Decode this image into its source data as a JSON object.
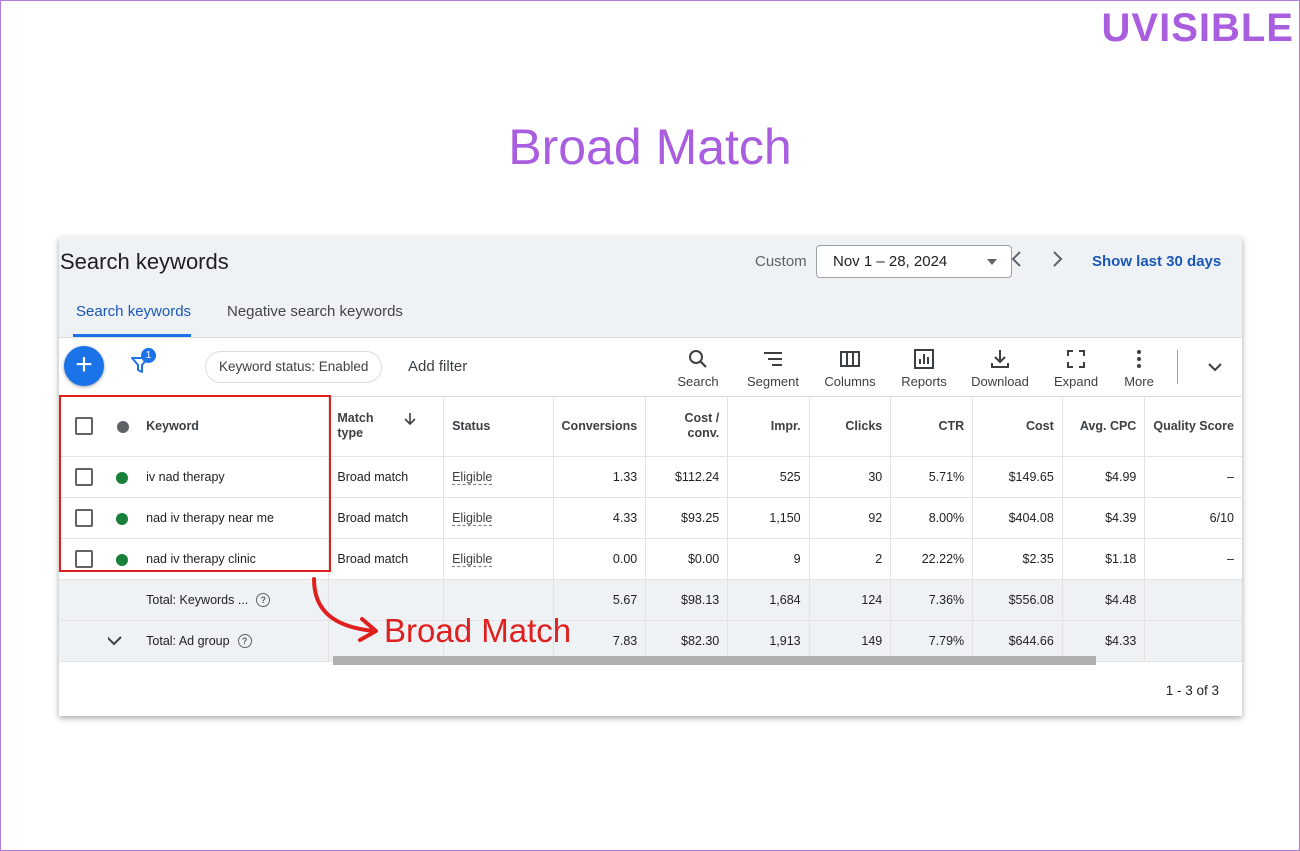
{
  "brand": "UVISIBLE",
  "headline": "Broad Match",
  "panel": {
    "title": "Search keywords",
    "date_label": "Custom",
    "date_range": "Nov 1 – 28, 2024",
    "show_last": "Show last 30 days",
    "tabs": [
      {
        "label": "Search keywords",
        "active": true
      },
      {
        "label": "Negative search keywords",
        "active": false
      }
    ]
  },
  "toolbar": {
    "filter_count": "1",
    "chip_label": "Keyword status: Enabled",
    "add_filter": "Add filter",
    "tools": [
      {
        "label": "Search",
        "icon": "search-icon"
      },
      {
        "label": "Segment",
        "icon": "segment-icon"
      },
      {
        "label": "Columns",
        "icon": "columns-icon"
      },
      {
        "label": "Reports",
        "icon": "reports-icon"
      },
      {
        "label": "Download",
        "icon": "download-icon"
      },
      {
        "label": "Expand",
        "icon": "expand-icon"
      },
      {
        "label": "More",
        "icon": "more-vert-icon"
      }
    ]
  },
  "table": {
    "headers": {
      "keyword": "Keyword",
      "match_type": "Match\ntype",
      "status": "Status",
      "conversions": "Conversions",
      "cost_conv": "Cost /\nconv.",
      "impr": "Impr.",
      "clicks": "Clicks",
      "ctr": "CTR",
      "cost": "Cost",
      "avg_cpc": "Avg. CPC",
      "quality": "Quality Score"
    },
    "rows": [
      {
        "keyword": "iv nad therapy",
        "match_type": "Broad match",
        "status": "Eligible",
        "conversions": "1.33",
        "cost_conv": "$112.24",
        "impr": "525",
        "clicks": "30",
        "ctr": "5.71%",
        "cost": "$149.65",
        "avg_cpc": "$4.99",
        "quality": "–"
      },
      {
        "keyword": "nad iv therapy near me",
        "match_type": "Broad match",
        "status": "Eligible",
        "conversions": "4.33",
        "cost_conv": "$93.25",
        "impr": "1,150",
        "clicks": "92",
        "ctr": "8.00%",
        "cost": "$404.08",
        "avg_cpc": "$4.39",
        "quality": "6/10"
      },
      {
        "keyword": "nad iv therapy clinic",
        "match_type": "Broad match",
        "status": "Eligible",
        "conversions": "0.00",
        "cost_conv": "$0.00",
        "impr": "9",
        "clicks": "2",
        "ctr": "22.22%",
        "cost": "$2.35",
        "avg_cpc": "$1.18",
        "quality": "–"
      }
    ],
    "totals": [
      {
        "label": "Total: Keywords ...",
        "conversions": "5.67",
        "cost_conv": "$98.13",
        "impr": "1,684",
        "clicks": "124",
        "ctr": "7.36%",
        "cost": "$556.08",
        "avg_cpc": "$4.48"
      },
      {
        "label": "Total: Ad group",
        "conversions": "7.83",
        "cost_conv": "$82.30",
        "impr": "1,913",
        "clicks": "149",
        "ctr": "7.79%",
        "cost": "$644.66",
        "avg_cpc": "$4.33"
      }
    ]
  },
  "pager": "1 - 3 of 3",
  "annotation": "Broad Match",
  "colors": {
    "accent_purple": "#a95ee0",
    "primary_blue": "#1a73e8",
    "link_blue": "#1a57b6",
    "status_green": "#188038",
    "annotation_red": "#e01f1f"
  }
}
